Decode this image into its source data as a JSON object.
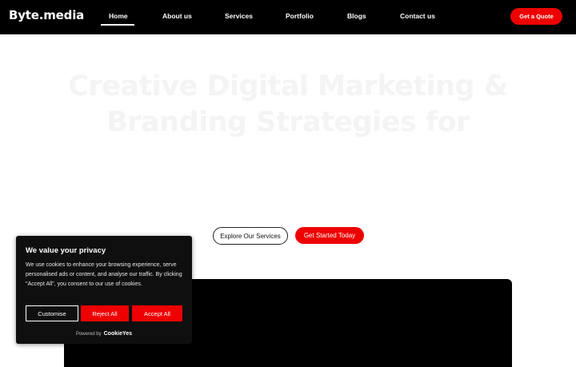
{
  "brand": {
    "logo": "Byte.media"
  },
  "nav": {
    "items": [
      {
        "label": "Home",
        "active": true
      },
      {
        "label": "About us"
      },
      {
        "label": "Services"
      },
      {
        "label": "Portfolio"
      },
      {
        "label": "Blogs"
      },
      {
        "label": "Contact us"
      }
    ],
    "cta_label": "Get a Quote"
  },
  "hero": {
    "eyebrow": "",
    "title_line1": "Creative Digital Marketing &",
    "title_line2": "Branding Strategies for",
    "title_line3": "",
    "subtitle": "",
    "btn_secondary": "Explore Our Services",
    "btn_primary": "Get Started Today"
  },
  "cookie": {
    "title": "We value your privacy",
    "body": "We use cookies to enhance your browsing experience, serve personalised ads or content, and analyse our traffic. By clicking \"Accept All\", you consent to our use of cookies.",
    "customise": "Customise",
    "reject": "Reject All",
    "accept": "Accept All",
    "powered_by": "Powered by",
    "powered_brand": "CookieYes"
  },
  "colors": {
    "accent": "#ee0000",
    "nav_bg": "#000000",
    "text_on_dark": "#ffffff"
  }
}
